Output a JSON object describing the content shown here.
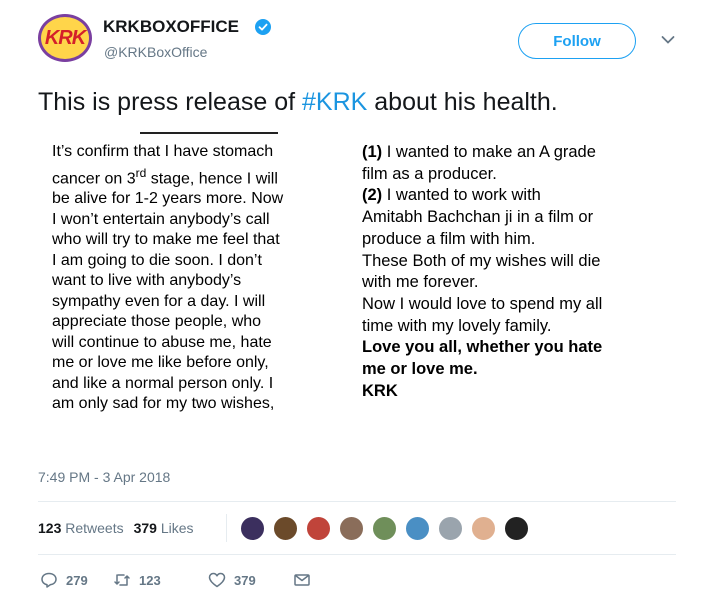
{
  "header": {
    "display_name": "KRKBOXOFFICE",
    "handle": "@KRKBoxOffice",
    "follow_label": "Follow",
    "avatar_text": "KRK"
  },
  "tweet": {
    "text_prefix": "This is press release of ",
    "hashtag": "#KRK",
    "text_suffix": " about his health."
  },
  "press_release": {
    "left_lines": [
      "It’s confirm that I have stomach",
      "cancer on 3rd stage, hence I will",
      "be alive for 1-2 years more. Now",
      "I won’t entertain anybody’s call",
      "who will try to make me feel that",
      "I am going to die soon. I don’t",
      "want to live with anybody’s",
      "sympathy even for a day. I will",
      "appreciate those people, who",
      "will continue to abuse me, hate",
      "me or love me like before only,",
      "and like a normal person only. I",
      "am only sad for my two wishes,"
    ],
    "line2_pre": "cancer on 3",
    "line2_sup": "rd",
    "line2_post": " stage, hence I will",
    "wish1_num": "(1)",
    "wish1_text": " I wanted to make an A grade",
    "wish1_text2": "film as a producer.",
    "wish2_num": "(2)",
    "wish2_text": " I wanted to work with",
    "wish2_text2": "Amitabh Bachchan ji in a film or",
    "wish2_text3": "produce a film with him.",
    "both_text": "These Both of my wishes will die",
    "both_text2": "with me forever.",
    "now_text": "Now I would love to spend my all",
    "now_text2": "time with my lovely family.",
    "love_text": "Love you all, whether you hate",
    "love_text2": "me or love me.",
    "signature": "KRK"
  },
  "timestamp": "7:49 PM - 3 Apr 2018",
  "stats": {
    "retweets_count": "123",
    "retweets_label": "Retweets",
    "likes_count": "379",
    "likes_label": "Likes"
  },
  "likers_colors": [
    "#3b2f5e",
    "#6b4a2a",
    "#c0443a",
    "#8a6d5a",
    "#6f8f5a",
    "#4a8fc4",
    "#9aa4ad",
    "#e0b090",
    "#222222"
  ],
  "actions": {
    "reply_count": "279",
    "retweet_count": "123",
    "like_count": "379"
  },
  "colors": {
    "accent": "#1da1f2",
    "hashtag": "#1b95e0",
    "muted": "#657786"
  }
}
